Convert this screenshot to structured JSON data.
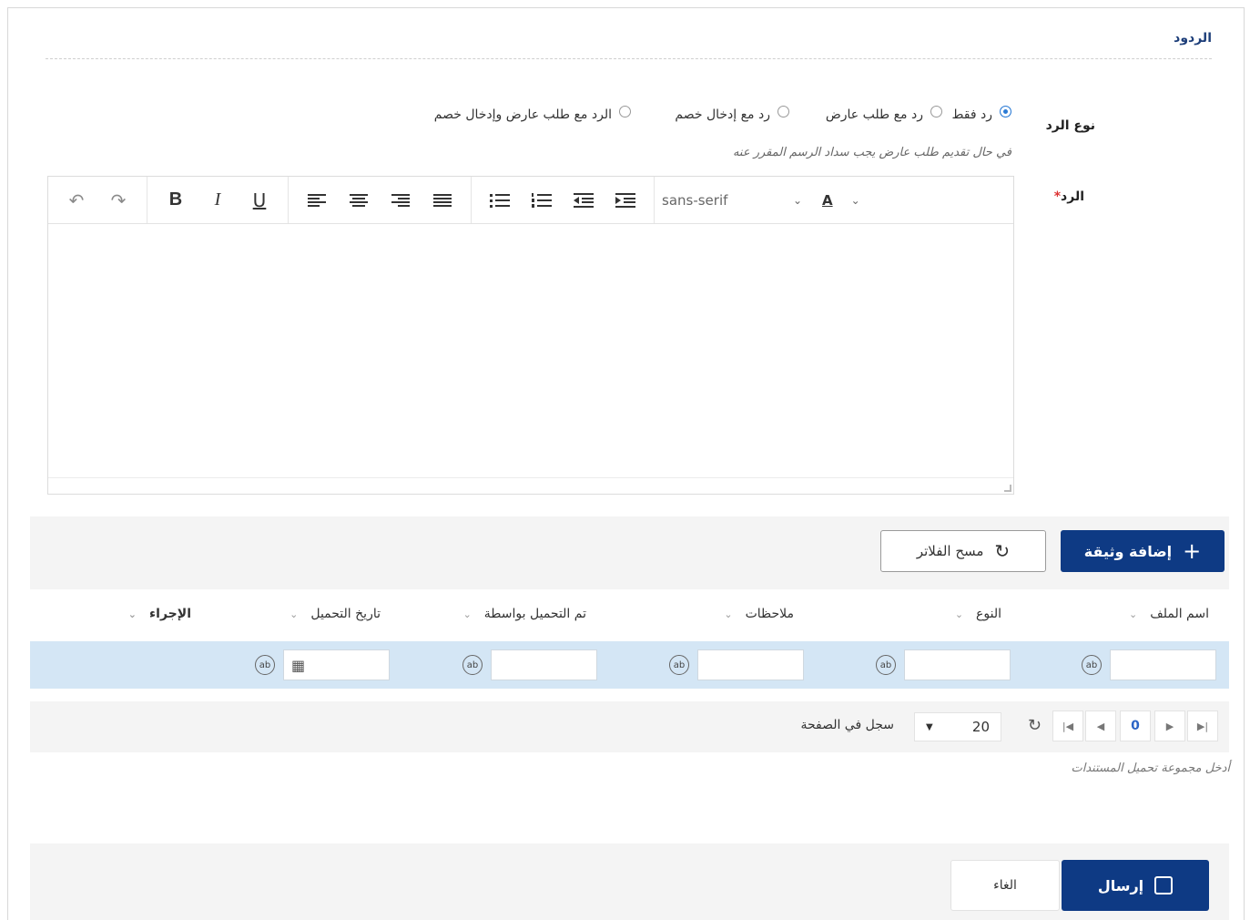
{
  "section": {
    "title": "الردود"
  },
  "reply_type": {
    "label": "نوع الرد",
    "options": [
      {
        "label": "رد فقط",
        "selected": true
      },
      {
        "label": "رد مع طلب عارض",
        "selected": false
      },
      {
        "label": "رد مع إدخال خصم",
        "selected": false
      },
      {
        "label": "الرد مع طلب عارض وإدخال خصم",
        "selected": false
      }
    ],
    "hint": "في حال تقديم طلب عارض يجب سداد الرسم المقرر عنه"
  },
  "reply": {
    "label": "الرد",
    "required_mark": "*",
    "editor": {
      "font_family_value": "sans-serif",
      "color_button_label": "A"
    }
  },
  "documents": {
    "add_button": "إضافة وثيقة",
    "clear_filters_button": "مسح الفلاتر",
    "columns": [
      {
        "label": "اسم الملف"
      },
      {
        "label": "النوع"
      },
      {
        "label": "ملاحظات"
      },
      {
        "label": "تم التحميل بواسطة"
      },
      {
        "label": "تاريخ التحميل"
      },
      {
        "label": "الإجراء"
      }
    ],
    "pager": {
      "current_page": "0",
      "page_size": "20",
      "per_page_label": "سجل في الصفحة"
    },
    "hint": "أدخل مجموعة تحميل المستندات"
  },
  "footer": {
    "send_button": "إرسال",
    "cancel_button": "الغاء"
  }
}
